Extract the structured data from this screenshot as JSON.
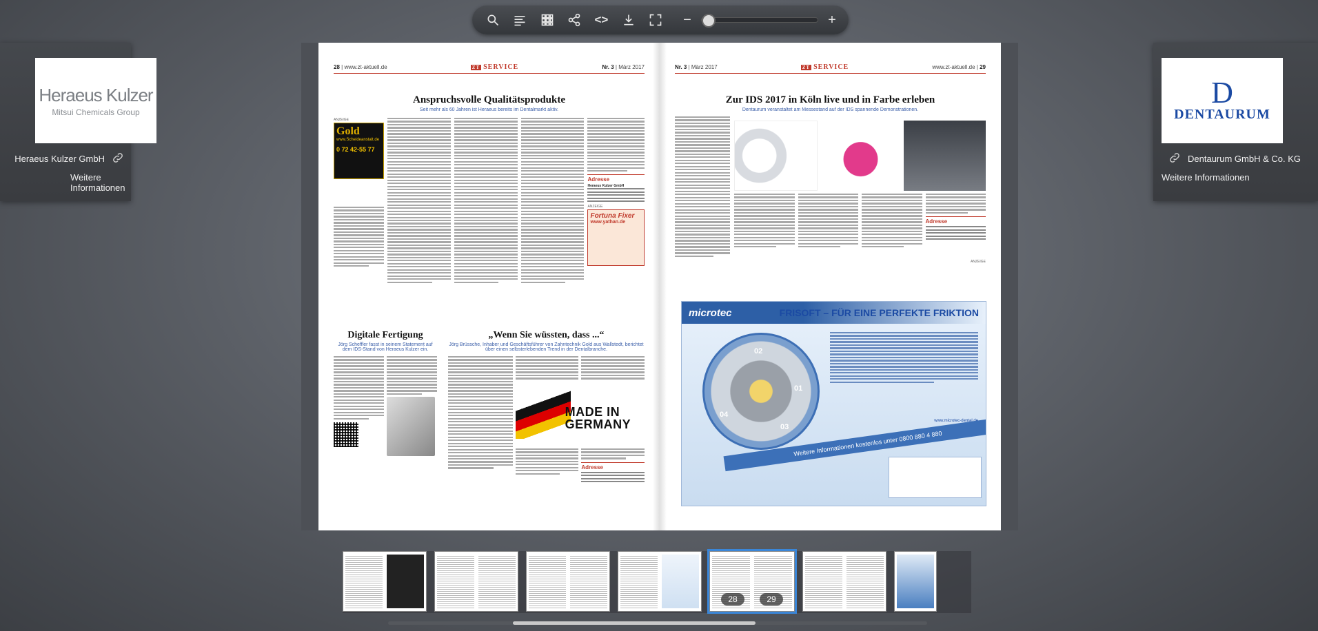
{
  "toolbar": {
    "zoom_level": 0.0,
    "icons": [
      "search-icon",
      "toc-icon",
      "grid-icon",
      "share-icon",
      "embed-icon",
      "download-icon",
      "fullscreen-icon",
      "zoom-out-icon",
      "zoom-in-icon"
    ],
    "embed_glyph": "<>",
    "minus_glyph": "−",
    "plus_glyph": "+"
  },
  "left_sponsor": {
    "logo_text": "Heraeus Kulzer",
    "logo_sub": "Mitsui Chemicals Group",
    "company": "Heraeus Kulzer GmbH",
    "more": "Weitere Informationen"
  },
  "right_sponsor": {
    "logo_mark": "D",
    "logo_text": "DENTAURUM",
    "company": "Dentaurum GmbH & Co. KG",
    "more": "Weitere Informationen"
  },
  "nav": {
    "prev": "‹",
    "next": "›"
  },
  "left_page": {
    "page_no": "28",
    "site": "www.zt-aktuell.de",
    "section_badge": "ZT",
    "section": "SERVICE",
    "issue": "Nr. 3",
    "date": "März 2017",
    "headline1": "Anspruchsvolle Qualitätsprodukte",
    "dek1": "Seit mehr als 60 Jahren ist Heraeus bereits im Dentalmarkt aktiv.",
    "ad_label": "ANZEIGE",
    "gold_ad_title": "Gold",
    "gold_ad_sub": "www.Scheideanstalt.de",
    "gold_ad_phone": "0 72 42-55 77",
    "adresse": "Adresse",
    "address_company": "Heraeus Kulzer GmbH",
    "fp_ad_title": "Fortuna Fixer",
    "fp_ad_site": "www.yathan.de",
    "headline2": "Digitale Fertigung",
    "dek2": "Jörg Scheffler fasst in seinem Statement auf dem IDS-Stand von Heraeus Kulzer ein.",
    "headline3": "„Wenn Sie wüssten, dass ...“",
    "dek3": "Jörg Brüssche, Inhaber und Geschäftsführer von Zahntechnik Gold aus Wallstedt, berichtet über einen selbsterlebenden Trend in der Dentalbranche.",
    "mig_line1": "MADE IN",
    "mig_line2": "GERMANY"
  },
  "right_page": {
    "issue": "Nr. 3",
    "date": "März 2017",
    "section_badge": "ZT",
    "section": "SERVICE",
    "site": "www.zt-aktuell.de",
    "page_no": "29",
    "headline": "Zur IDS 2017 in Köln live und in Farbe erleben",
    "dek": "Dentaurum veranstaltet am Messestand auf der IDS spannende Demonstrationen.",
    "adresse": "Adresse",
    "ad_label": "ANZEIGE",
    "microtec_brand": "microtec",
    "microtec_title": "FRISOFT – FÜR EINE PERFEKTE FRIKTION",
    "microtec_banner": "Weitere Informationen kostenlos unter 0800 880 4 880",
    "microtec_site": "www.microtec-dental.de",
    "wheel_labels": [
      "01",
      "02",
      "03",
      "04"
    ]
  },
  "thumbnails": {
    "active_pages": [
      "28",
      "29"
    ]
  },
  "scrollbar": {
    "position": 0.42,
    "size": 0.45
  }
}
